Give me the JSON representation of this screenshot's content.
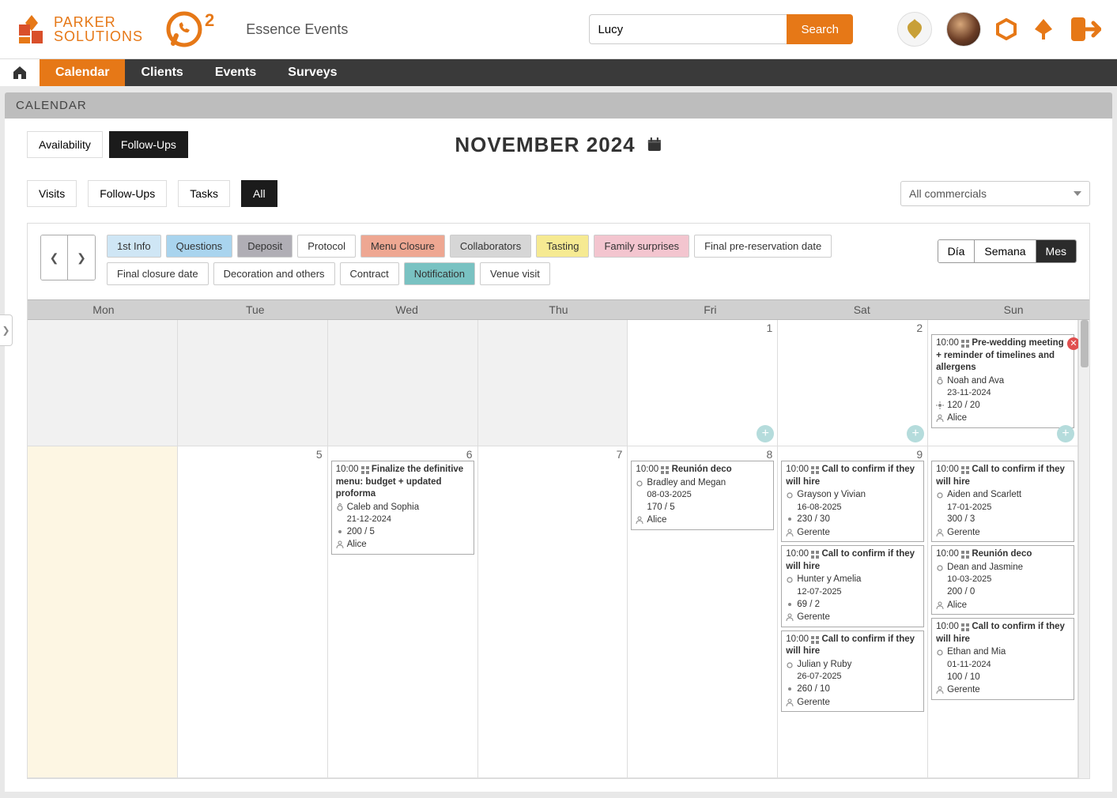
{
  "brand": {
    "line1": "PARKER",
    "line2": "SOLUTIONS"
  },
  "whatsapp_badge": "2",
  "company_name": "Essence Events",
  "search": {
    "value": "Lucy",
    "button": "Search"
  },
  "nav": {
    "home_label": "Home",
    "items": [
      "Calendar",
      "Clients",
      "Events",
      "Surveys"
    ],
    "active_index": 0
  },
  "page_title": "CALENDAR",
  "primary_tabs": {
    "availability": "Availability",
    "followups": "Follow-Ups"
  },
  "month_title": "NOVEMBER 2024",
  "sub_tabs": {
    "visits": "Visits",
    "followups": "Follow-Ups",
    "tasks": "Tasks",
    "all": "All"
  },
  "commercials_placeholder": "All commercials",
  "categories": [
    {
      "label": "1st Info",
      "bg": "#cfe6f5"
    },
    {
      "label": "Questions",
      "bg": "#a9d4ee"
    },
    {
      "label": "Deposit",
      "bg": "#b0aeb5"
    },
    {
      "label": "Protocol",
      "bg": "#ffffff"
    },
    {
      "label": "Menu Closure",
      "bg": "#eea792"
    },
    {
      "label": "Collaborators",
      "bg": "#d6d6d6"
    },
    {
      "label": "Tasting",
      "bg": "#f6ea92"
    },
    {
      "label": "Family surprises",
      "bg": "#f3c5cf"
    },
    {
      "label": "Final pre-reservation date",
      "bg": "#ffffff"
    },
    {
      "label": "Final closure date",
      "bg": "#ffffff"
    },
    {
      "label": "Decoration and others",
      "bg": "#ffffff"
    },
    {
      "label": "Contract",
      "bg": "#ffffff"
    },
    {
      "label": "Notification",
      "bg": "#79c2c2"
    },
    {
      "label": "Venue visit",
      "bg": "#ffffff"
    }
  ],
  "view_toggle": {
    "dia": "Día",
    "semana": "Semana",
    "mes": "Mes"
  },
  "weekdays": [
    "Mon",
    "Tue",
    "Wed",
    "Thu",
    "Fri",
    "Sat",
    "Sun"
  ],
  "days_row1": [
    "",
    "",
    "",
    "",
    "1",
    "2",
    ""
  ],
  "days_row2": [
    "",
    "5",
    "6",
    "7",
    "8",
    "9",
    ""
  ],
  "events": {
    "sun_row1": {
      "time": "10:00",
      "title": "Pre-wedding meeting + reminder of timelines and allergens",
      "couple": "Noah and Ava",
      "date": "23-11-2024",
      "guests": "120 / 20",
      "owner": "Alice"
    },
    "wed_row2": {
      "time": "10:00",
      "title": "Finalize the definitive menu: budget + updated proforma",
      "couple": "Caleb and Sophia",
      "date": "21-12-2024",
      "guests": "200 / 5",
      "owner": "Alice"
    },
    "fri_row2": {
      "time": "10:00",
      "title": "Reunión deco",
      "couple": "Bradley and Megan",
      "date": "08-03-2025",
      "guests": "170 / 5",
      "owner": "Alice"
    },
    "sat_row2_a": {
      "time": "10:00",
      "title": "Call to confirm if they will hire",
      "couple": "Grayson y Vivian",
      "date": "16-08-2025",
      "guests": "230 / 30",
      "owner": "Gerente"
    },
    "sat_row2_b": {
      "time": "10:00",
      "title": "Call to confirm if they will hire",
      "couple": "Hunter y Amelia",
      "date": "12-07-2025",
      "guests": "69 / 2",
      "owner": "Gerente"
    },
    "sat_row2_c": {
      "time": "10:00",
      "title": "Call to confirm if they will hire",
      "couple": "Julian y Ruby",
      "date": "26-07-2025",
      "guests": "260 / 10",
      "owner": "Gerente"
    },
    "sun_row2_a": {
      "time": "10:00",
      "title": "Call to confirm if they will hire",
      "couple": "Aiden and Scarlett",
      "date": "17-01-2025",
      "guests": "300 / 3",
      "owner": "Gerente"
    },
    "sun_row2_b": {
      "time": "10:00",
      "title": "Reunión deco",
      "couple": "Dean and Jasmine",
      "date": "10-03-2025",
      "guests": "200 / 0",
      "owner": "Alice"
    },
    "sun_row2_c": {
      "time": "10:00",
      "title": "Call to confirm if they will hire",
      "couple": "Ethan and Mia",
      "date": "01-11-2024",
      "guests": "100 / 10",
      "owner": "Gerente"
    }
  }
}
